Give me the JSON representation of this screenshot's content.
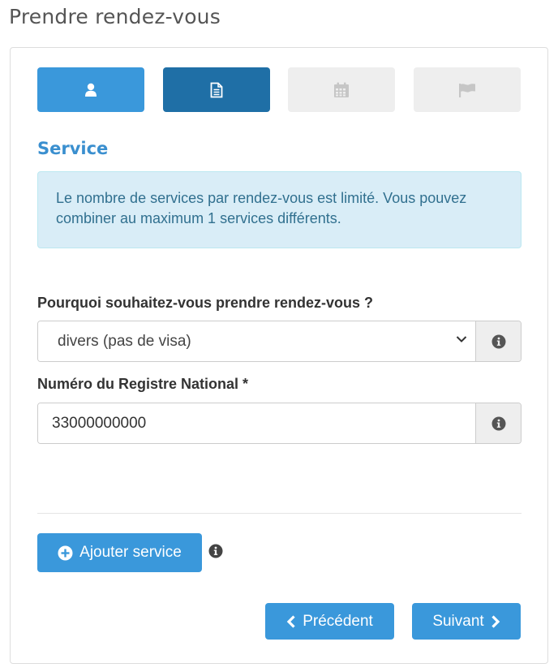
{
  "page": {
    "title": "Prendre rendez-vous"
  },
  "steps": [
    {
      "icon": "user-icon",
      "state": "completed"
    },
    {
      "icon": "document-icon",
      "state": "active"
    },
    {
      "icon": "calendar-icon",
      "state": "disabled"
    },
    {
      "icon": "flag-icon",
      "state": "disabled"
    }
  ],
  "section": {
    "title": "Service"
  },
  "alert": {
    "text": "Le nombre de services par rendez-vous est limité. Vous pouvez combiner au maximum 1 services différents."
  },
  "form": {
    "reason": {
      "label": "Pourquoi souhaitez-vous prendre rendez-vous ?",
      "value": "divers (pas de visa)"
    },
    "nrn": {
      "label": "Numéro du Registre National *",
      "value": "33000000000"
    }
  },
  "buttons": {
    "add_service": "Ajouter service",
    "previous": "Précédent",
    "next": "Suivant"
  },
  "colors": {
    "primary": "#3a98db",
    "primary_dark": "#1f6fa6",
    "disabled_step": "#eeeeee",
    "section_title": "#3a8fcf",
    "alert_bg": "#d9edf7",
    "alert_text": "#31708f"
  }
}
